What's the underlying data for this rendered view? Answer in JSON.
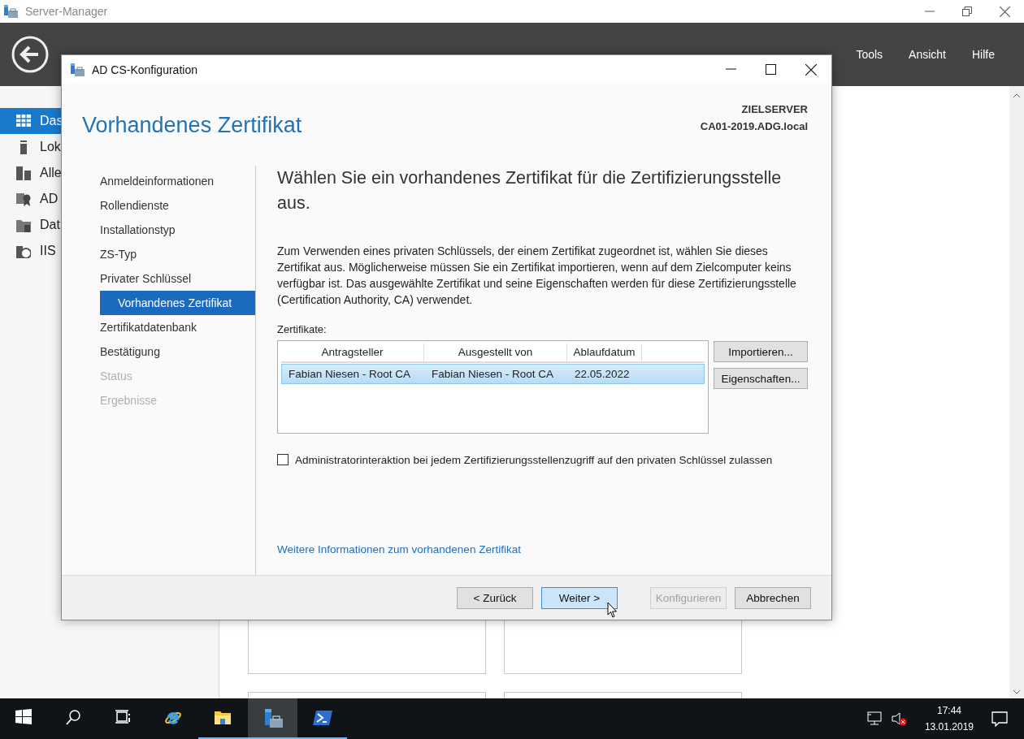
{
  "window": {
    "title": "Server-Manager"
  },
  "header": {
    "menu": [
      {
        "label": "Tools"
      },
      {
        "label": "Ansicht"
      },
      {
        "label": "Hilfe"
      }
    ]
  },
  "sidebar": {
    "items": [
      {
        "label": "Das",
        "kind": "dashboard",
        "selected": true
      },
      {
        "label": "Lok",
        "kind": "server",
        "selected": false
      },
      {
        "label": "Alle",
        "kind": "servers",
        "selected": false
      },
      {
        "label": "AD",
        "kind": "certificate",
        "selected": false
      },
      {
        "label": "Dat",
        "kind": "files",
        "selected": false
      },
      {
        "label": "IIS",
        "kind": "web",
        "selected": false
      }
    ]
  },
  "dialog": {
    "title": "AD CS-Konfiguration",
    "heading": "Vorhandenes Zertifikat",
    "target_label": "ZIELSERVER",
    "target_server": "CA01-2019.ADG.local",
    "steps": [
      {
        "label": "Anmeldeinformationen",
        "selected": false,
        "disabled": false
      },
      {
        "label": "Rollendienste",
        "selected": false,
        "disabled": false
      },
      {
        "label": "Installationstyp",
        "selected": false,
        "disabled": false
      },
      {
        "label": "ZS-Typ",
        "selected": false,
        "disabled": false
      },
      {
        "label": "Privater Schlüssel",
        "selected": false,
        "disabled": false,
        "children": [
          {
            "label": "Vorhandenes Zertifikat",
            "selected": true,
            "disabled": false
          }
        ]
      },
      {
        "label": "Zertifikatdatenbank",
        "selected": false,
        "disabled": false
      },
      {
        "label": "Bestätigung",
        "selected": false,
        "disabled": false
      },
      {
        "label": "Status",
        "selected": false,
        "disabled": true
      },
      {
        "label": "Ergebnisse",
        "selected": false,
        "disabled": true
      }
    ],
    "instruction": "Wählen Sie ein vorhandenes Zertifikat für die Zertifizierungsstelle aus.",
    "description": "Zum Verwenden eines privaten Schlüssels, der einem Zertifikat zugeordnet ist, wählen Sie dieses Zertifikat aus. Möglicherweise müssen Sie ein Zertifikat importieren, wenn auf dem Zielcomputer keins verfügbar ist. Das ausgewählte Zertifikat und seine Eigenschaften werden für diese Zertifizierungsstelle (Certification Authority, CA) verwendet.",
    "certificates": {
      "label": "Zertifikate:",
      "columns": [
        "Antragsteller",
        "Ausgestellt von",
        "Ablaufdatum"
      ],
      "rows": [
        {
          "cells": [
            "Fabian Niesen - Root CA",
            "Fabian Niesen - Root CA",
            "22.05.2022"
          ],
          "selected": true
        }
      ]
    },
    "side_buttons": [
      {
        "label": "Importieren..."
      },
      {
        "label": "Eigenschaften..."
      }
    ],
    "admin_interaction": {
      "label": "Administratorinteraktion bei jedem Zertifizierungsstellenzugriff auf den privaten Schlüssel zulassen",
      "checked": false
    },
    "link": "Weitere Informationen zum vorhandenen Zertifikat",
    "buttons": [
      {
        "label": "< Zurück",
        "disabled": false,
        "focused": false
      },
      {
        "label": "Weiter >",
        "disabled": false,
        "focused": true
      },
      {
        "label": "Konfigurieren",
        "disabled": true,
        "focused": false
      },
      {
        "label": "Abbrechen",
        "disabled": false,
        "focused": false
      }
    ]
  },
  "taskbar": {
    "apps": [
      {
        "kind": "start",
        "running": false,
        "selected": false
      },
      {
        "kind": "search",
        "running": false,
        "selected": false
      },
      {
        "kind": "taskview",
        "running": false,
        "selected": false
      },
      {
        "kind": "browser",
        "running": false,
        "selected": false
      },
      {
        "kind": "explorer",
        "running": true,
        "selected": false
      },
      {
        "kind": "servermanager",
        "running": true,
        "selected": true
      },
      {
        "kind": "powershell",
        "running": true,
        "selected": false
      }
    ],
    "clock": {
      "time": "17:44",
      "date": "13.01.2019"
    }
  }
}
